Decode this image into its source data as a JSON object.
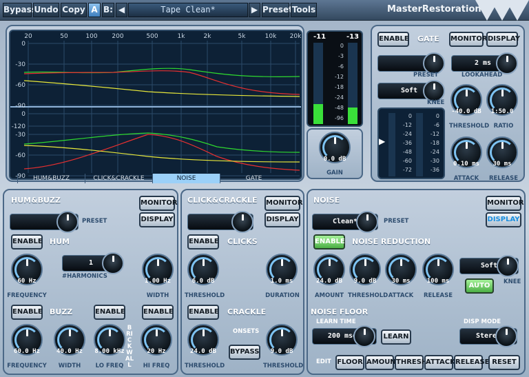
{
  "toolbar": {
    "bypass": "Bypass",
    "undo": "Undo",
    "copy": "Copy",
    "a": "A",
    "b": "B:",
    "prev": "◀",
    "preset_name": "Tape Clean*",
    "next": "▶",
    "preset": "Preset",
    "tools": "Tools",
    "brand": "MasterRestoration"
  },
  "graph": {
    "freq_labels": [
      "20",
      "50",
      "100",
      "200",
      "500",
      "1k",
      "2k",
      "5k",
      "10k",
      "20k"
    ],
    "db_labels": [
      "0",
      "-30",
      "-60",
      "-90",
      "-120"
    ],
    "tabs": [
      "HUM&BUZZ",
      "CLICK&CRACKLE",
      "NOISE",
      "GATE"
    ],
    "selected_tab": "NOISE"
  },
  "meter": {
    "peak_left": "-11",
    "peak_right": "-13",
    "scale": [
      "0",
      "-3",
      "-6",
      "-12",
      "-18",
      "-24",
      "-48",
      "-96"
    ],
    "gain_value": "0.0 dB",
    "gain_label": "GAIN",
    "level_left": 0.25,
    "level_right": 0.2
  },
  "gate": {
    "enable": "ENABLE",
    "title": "GATE",
    "monitor": "MONITOR",
    "display": "DISPLAY",
    "preset_label": "PRESET",
    "lookahead_value": "2 ms",
    "lookahead_label": "LOOKAHEAD",
    "knee_value": "Soft",
    "knee_label": "KNEE",
    "threshold_value": "-40.0 dB",
    "threshold_label": "THRESHOLD",
    "ratio_value": "1:50.0",
    "ratio_label": "RATIO",
    "attack_value": "0.10 ms",
    "attack_label": "ATTACK",
    "release_value": "30 ms",
    "release_label": "RELEASE",
    "scale_left": [
      "0",
      "-12",
      "-24",
      "-36",
      "-48",
      "-60",
      "-72"
    ],
    "scale_right": [
      "0",
      "-6",
      "-12",
      "-18",
      "-24",
      "-30",
      "-36"
    ]
  },
  "hum": {
    "title": "HUM&BUZZ",
    "preset_label": "PRESET",
    "monitor": "MONITOR",
    "display": "DISPLAY",
    "enable": "ENABLE",
    "hum_label": "HUM",
    "frequency_value": "60 Hz",
    "frequency_label": "FREQUENCY",
    "harmonics_value": "1",
    "harmonics_label": "#HARMONICS",
    "width_value": "1.00 Hz",
    "width_label": "WIDTH",
    "buzz_enable": "ENABLE",
    "buzz_label": "BUZZ",
    "buzz_freq_value": "60.0 Hz",
    "buzz_freq_label": "FREQUENCY",
    "buzz_width_value": "40.0 Hz",
    "buzz_width_label": "WIDTH",
    "lo_enable": "ENABLE",
    "hi_enable": "ENABLE",
    "brickwall": "BRICKWALL",
    "lo_value": "8.00 kHz",
    "lo_label": "LO FREQ",
    "hi_value": "20 Hz",
    "hi_label": "HI FREQ"
  },
  "click": {
    "title": "CLICK&CRACKLE",
    "monitor": "MONITOR",
    "display": "DISPLAY",
    "enable": "ENABLE",
    "clicks_label": "CLICKS",
    "threshold_value": "6.0 dB",
    "threshold_label": "THRESHOLD",
    "duration_value": "1.0 ms",
    "duration_label": "DURATION",
    "crackle_enable": "ENABLE",
    "crackle_label": "CRACKLE",
    "crackle_threshold_value": "24.0 dB",
    "crackle_threshold_label": "THRESHOLD",
    "onsets_label": "ONSETS",
    "bypass": "BYPASS",
    "onset_threshold_value": "9.0 dB",
    "onset_threshold_label": "THRESHOLD"
  },
  "noise": {
    "title": "NOISE",
    "monitor": "MONITOR",
    "display": "DISPLAY",
    "preset_value": "Clean*",
    "preset_label": "PRESET",
    "enable": "ENABLE",
    "nr_label": "NOISE REDUCTION",
    "amount_value": "24.0 dB",
    "amount_label": "AMOUNT",
    "threshold_value": "9.0 dB",
    "threshold_label": "THRESHOLD",
    "attack_value": "30 ms",
    "attack_label": "ATTACK",
    "release_value": "100 ms",
    "release_label": "RELEASE",
    "knee_value": "Soft",
    "knee_label": "KNEE",
    "auto": "AUTO",
    "floor_label": "NOISE FLOOR",
    "learn_time_label": "LEARN TIME",
    "learn_time_value": "200 msec",
    "learn": "LEARN",
    "disp_mode_label": "DISP MODE",
    "disp_mode_value": "Stereo",
    "edit_label": "EDIT",
    "edit_buttons": [
      "FLOOR",
      "AMOUNT",
      "THRESH",
      "ATTACK",
      "RELEASE"
    ],
    "reset": "RESET"
  }
}
